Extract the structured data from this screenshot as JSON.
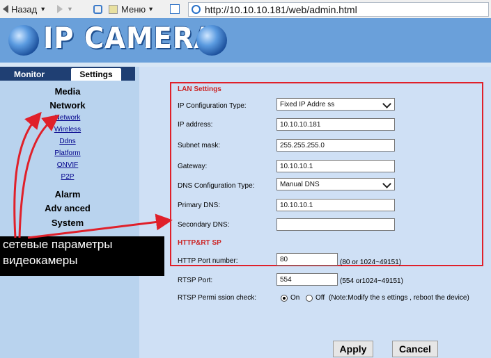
{
  "browser": {
    "back_label": "Назад",
    "menu_label": "Меню",
    "url": "http://10.10.10.181/web/admin.html"
  },
  "header": {
    "logo_text": "IP CAMERA"
  },
  "tabs": {
    "monitor": "Monitor",
    "settings": "Settings"
  },
  "sidebar": {
    "media": "Media",
    "network": "Network",
    "network_items": [
      "Network",
      "Wireless",
      "Ddns",
      "Platform",
      "ONVIF",
      "P2P"
    ],
    "alarm": "Alarm",
    "advanced": "Adv anced",
    "system": "System"
  },
  "lan": {
    "title": "LAN Settings",
    "ip_type_label": "IP Configuration Type:",
    "ip_type_value": "Fixed IP Addre ss",
    "ip_label": "IP address:",
    "ip_value": "10.10.10.181",
    "subnet_label": "Subnet mask:",
    "subnet_value": "255.255.255.0",
    "gateway_label": "Gateway:",
    "gateway_value": "10.10.10.1",
    "dns_type_label": "DNS Configuration Type:",
    "dns_type_value": "Manual DNS",
    "primary_dns_label": "Primary DNS:",
    "primary_dns_value": "10.10.10.1",
    "secondary_dns_label": "Secondary DNS:",
    "secondary_dns_value": ""
  },
  "http_rtsp": {
    "title": "HTTP&RT SP",
    "http_port_label": "HTTP Port number:",
    "http_port_value": "80",
    "http_port_hint": "(80 or 1024~49151)",
    "rtsp_port_label": "RTSP Port:",
    "rtsp_port_value": "554",
    "rtsp_port_hint": "(554 or1024~49151)",
    "rtsp_perm_label": "RTSP Permi ssion check:",
    "on_label": "On",
    "off_label": "Off",
    "note": "(Note:Modify the s ettings , reboot the device)"
  },
  "buttons": {
    "apply": "Apply",
    "cancel": "Cancel"
  },
  "annotation": {
    "line1": "сетевые параметры",
    "line2": "видеокамеры"
  },
  "colors": {
    "highlight": "#e0202a",
    "header": "#6aa0da",
    "panel": "#b9d3ee"
  }
}
